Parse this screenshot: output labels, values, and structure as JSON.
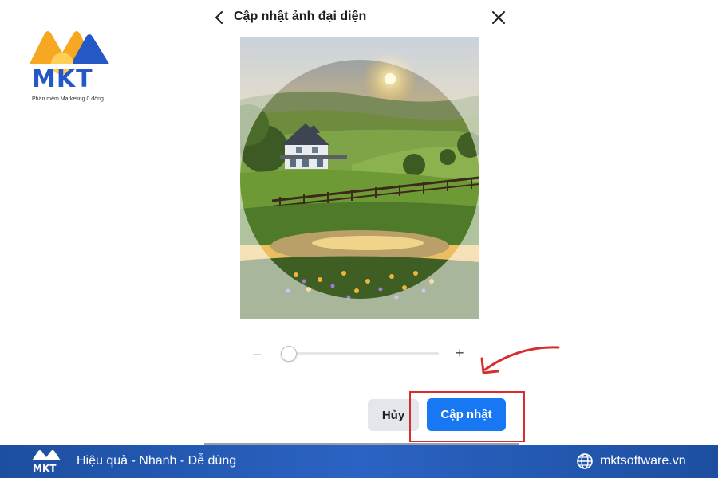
{
  "brand": {
    "logo_text": "MKT",
    "tagline": "Phần mềm Marketing 0 đồng",
    "colors": {
      "orange": "#f7a823",
      "blue": "#2458c6"
    }
  },
  "dialog": {
    "title": "Cập nhật ảnh đại diện",
    "back_icon": "chevron-left-icon",
    "close_icon": "close-icon",
    "zoom": {
      "minus": "–",
      "plus": "+",
      "level": 0.03
    },
    "cancel_label": "Hủy",
    "update_label": "Cập nhật",
    "accent_color": "#1877f2"
  },
  "annotation": {
    "color": "#d92c2c"
  },
  "footer": {
    "slogan": "Hiệu quả - Nhanh - Dễ dùng",
    "website": "mktsoftware.vn",
    "globe_icon": "globe-icon"
  }
}
